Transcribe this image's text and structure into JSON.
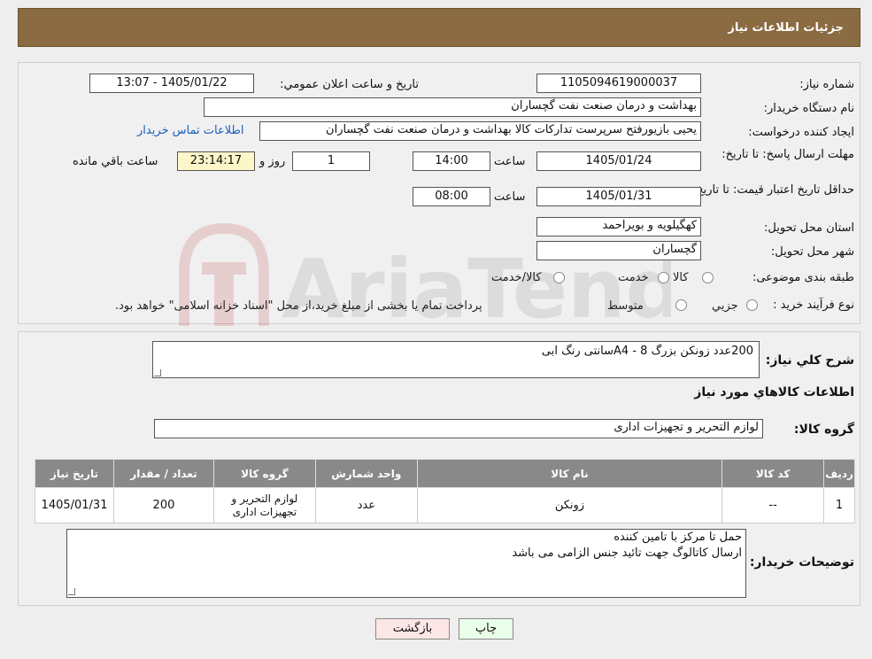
{
  "header": {
    "title": "جزئیات اطلاعات نیاز"
  },
  "fields": {
    "need_number_label": "شماره نیاز:",
    "need_number": "1105094619000037",
    "announce_label": "تاریخ و ساعت اعلان عمومي:",
    "announce_value": "1405/01/22 - 13:07",
    "buyer_org_label": "نام دستگاه خریدار:",
    "buyer_org": "بهداشت و درمان صنعت نفت گچساران",
    "creator_label": "ایجاد کننده درخواست:",
    "creator": "یحیی بازیورفتح سرپرست تدارکات کالا  بهداشت و درمان صنعت نفت گچساران",
    "contact_link": "اطلاعات تماس خریدار",
    "reply_deadline_label": "مهلت ارسال پاسخ: تا تاریخ:",
    "reply_date": "1405/01/24",
    "time_label": "ساعت",
    "reply_time": "14:00",
    "days_value": "1",
    "days_label": "روز و",
    "remaining_time": "23:14:17",
    "remaining_label": "ساعت باقي مانده",
    "price_validity_label": "حداقل تاریخ اعتبار قیمت: تا تاریخ:",
    "price_date": "1405/01/31",
    "price_time": "08:00",
    "province_label": "استان محل تحویل:",
    "province": "کهگیلویه و بویراحمد",
    "city_label": "شهر محل تحویل:",
    "city": "گچساران",
    "category_label": "طبقه بندی موضوعی:",
    "category_options": [
      "کالا",
      "خدمت",
      "کالا/خدمت"
    ],
    "process_label": "نوع فرآیند خرید :",
    "process_options": [
      "جزیي",
      "متوسط"
    ],
    "process_note": "پرداخت تمام یا بخشی از مبلغ خرید،از محل \"اسناد خزانه اسلامی\" خواهد بود."
  },
  "summary": {
    "label": "شرح کلي نیاز:",
    "value": "200عدد زونکن بزرگ 8 - A4سانتی رنگ ابی",
    "items_title": "اطلاعات کالاهاي مورد نیاز",
    "group_label": "گروه کالا:",
    "group_value": "لوازم التحریر و تجهیزات اداری"
  },
  "table": {
    "headers": [
      "ردیف",
      "کد کالا",
      "نام کالا",
      "واحد شمارش",
      "گروه کالا",
      "تعداد / مقدار",
      "تاریخ نیاز"
    ],
    "rows": [
      [
        "1",
        "--",
        "زونکن",
        "عدد",
        "لوازم التحریر و تجهیزات اداری",
        "200",
        "1405/01/31"
      ]
    ]
  },
  "notes": {
    "label": "توضیحات خریدار:",
    "line1": "حمل تا مرکز با تامین کننده",
    "line2": "ارسال کاتالوگ جهت تائید جنس الزامی می باشد"
  },
  "buttons": {
    "print": "چاپ",
    "back": "بازگشت"
  },
  "watermark": {
    "text": "AriaTender.neT"
  },
  "colors": {
    "header": "#8b6b42",
    "link": "#1a5fbf",
    "table_header": "#898989",
    "back_button": "#fde6e6",
    "print_button": "#eaffea"
  }
}
